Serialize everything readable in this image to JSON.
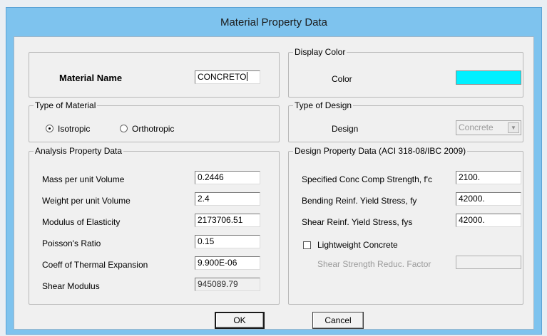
{
  "window": {
    "title": "Material Property Data"
  },
  "material_name": {
    "label": "Material Name",
    "value": "CONCRETO"
  },
  "display_color": {
    "legend": "Display Color",
    "label": "Color",
    "color": "#00f0ff"
  },
  "type_of_material": {
    "legend": "Type of Material",
    "options": [
      {
        "label": "Isotropic",
        "selected": true
      },
      {
        "label": "Orthotropic",
        "selected": false
      }
    ]
  },
  "type_of_design": {
    "legend": "Type of Design",
    "label": "Design",
    "value": "Concrete",
    "arrow_icon": "chevron-down-icon"
  },
  "analysis": {
    "legend": "Analysis Property Data",
    "rows": [
      {
        "label": "Mass per unit Volume",
        "value": "0.2446"
      },
      {
        "label": "Weight per unit Volume",
        "value": "2.4"
      },
      {
        "label": "Modulus of Elasticity",
        "value": "2173706.51"
      },
      {
        "label": "Poisson's Ratio",
        "value": "0.15"
      },
      {
        "label": "Coeff of Thermal Expansion",
        "value": "9.900E-06"
      },
      {
        "label": "Shear Modulus",
        "value": "945089.79"
      }
    ]
  },
  "design": {
    "legend": "Design Property Data (ACI 318-08/IBC 2009)",
    "rows": [
      {
        "label": "Specified Conc Comp Strength, f'c",
        "value": "2100."
      },
      {
        "label": "Bending Reinf. Yield Stress, fy",
        "value": "42000."
      },
      {
        "label": "Shear Reinf. Yield Stress, fys",
        "value": "42000."
      }
    ],
    "lightweight_label": "Lightweight Concrete",
    "lightweight_checked": false,
    "shear_factor_label": "Shear Strength Reduc. Factor",
    "shear_factor_value": ""
  },
  "buttons": {
    "ok": "OK",
    "cancel": "Cancel"
  },
  "colors": {
    "titlebar": "#7ec3ee",
    "client": "#f0f0f0",
    "swatch": "#00f0ff"
  }
}
